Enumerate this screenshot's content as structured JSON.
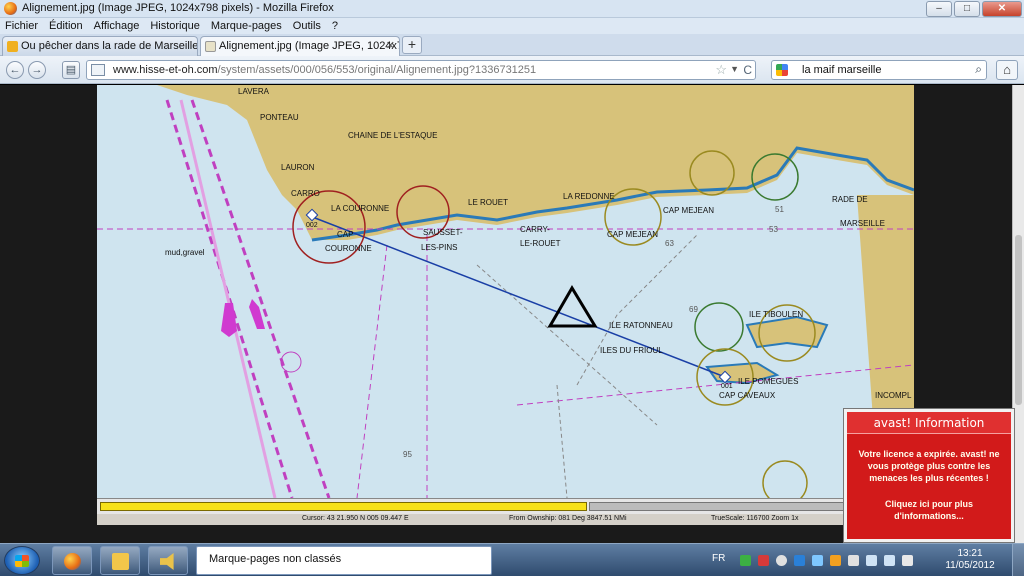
{
  "window": {
    "title": "Alignement.jpg (Image JPEG, 1024x798 pixels) - Mozilla Firefox",
    "min": "–",
    "max": "□",
    "close": "✕"
  },
  "menu": [
    "Fichier",
    "Édition",
    "Affichage",
    "Historique",
    "Marque-pages",
    "Outils",
    "?"
  ],
  "tabs": [
    {
      "label": "Ou pêcher dans la rade de Marseille",
      "close": "✕"
    },
    {
      "label": "Alignement.jpg (Image JPEG, 1024x79...",
      "close": "✕"
    }
  ],
  "newtab": "+",
  "nav": {
    "back": "←",
    "forward": "→",
    "bookmark": "▤",
    "url_host": "www.hisse-et-oh.com",
    "url_path": "/system/assets/000/056/553/original/Alignement.jpg?1336731251",
    "star": "☆",
    "dropdown": "▼",
    "reload": "C",
    "search_query": "la maif marseille",
    "search_icon": "⌕",
    "home": "⌂"
  },
  "map": {
    "places": [
      "LAVERA",
      "PONTEAU",
      "CHAINE DE L'ESTAQUE",
      "LAURON",
      "CARRO",
      "LA COURONNE",
      "CAP",
      "COURONNE",
      "SAUSSET-",
      "LES-PINS",
      "LE ROUET",
      "CARRY-",
      "LE-ROUET",
      "LA REDONNE",
      "CAP MEJEAN",
      "CAP MEJEAN",
      "RADE DE",
      "MARSEILLE",
      "ILE RATONNEAU",
      "ILES DU FRIOUL",
      "ILE POMEGUES",
      "CAP CAVEAUX",
      "ILE TIBOULEN",
      "INCOMPL",
      "mud,gravel"
    ],
    "waypoints": [
      "002",
      "001"
    ],
    "soundings": [
      "53",
      "51",
      "63",
      "69",
      "95"
    ]
  },
  "status": {
    "cursor": "Cursor:   43 21.950 N   005 09.447 E",
    "ownship": "From Ownship: 081 Deg   3847.51 NMi",
    "scale": "TrueScale:   116700  Zoom   1x"
  },
  "avast": {
    "title": "avast! Information",
    "message": "Votre licence a expirée. avast! ne vous protège plus contre les menaces les plus récentes !",
    "link": "Cliquez ici pour plus d'informations..."
  },
  "taskbar": {
    "window_label": "Marque-pages non classés",
    "lang": "FR",
    "time": "13:21",
    "date": "11/05/2012"
  }
}
